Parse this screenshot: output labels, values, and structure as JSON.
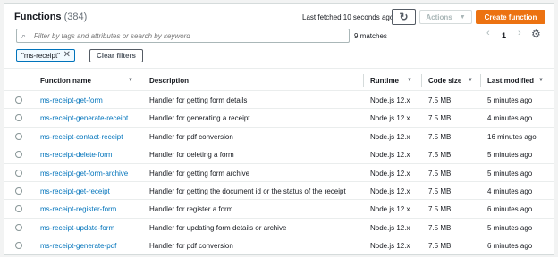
{
  "header": {
    "title": "Functions",
    "count": "(384)",
    "last_fetched": "Last fetched 10 seconds ago",
    "actions_label": "Actions",
    "create_label": "Create function"
  },
  "search": {
    "placeholder": "Filter by tags and attributes or search by keyword",
    "matches": "9 matches"
  },
  "pagination": {
    "page": "1"
  },
  "filter": {
    "token": "\"ms-receipt\"",
    "clear_label": "Clear filters"
  },
  "columns": [
    "Function name",
    "Description",
    "Runtime",
    "Code size",
    "Last modified"
  ],
  "rows": [
    {
      "name": "ms-receipt-get-form",
      "description": "Handler for getting form details",
      "runtime": "Node.js 12.x",
      "size": "7.5 MB",
      "modified": "5 minutes ago"
    },
    {
      "name": "ms-receipt-generate-receipt",
      "description": "Handler for generating a receipt",
      "runtime": "Node.js 12.x",
      "size": "7.5 MB",
      "modified": "4 minutes ago"
    },
    {
      "name": "ms-receipt-contact-receipt",
      "description": "Handler for pdf conversion",
      "runtime": "Node.js 12.x",
      "size": "7.5 MB",
      "modified": "16 minutes ago"
    },
    {
      "name": "ms-receipt-delete-form",
      "description": "Handler for deleting a form",
      "runtime": "Node.js 12.x",
      "size": "7.5 MB",
      "modified": "5 minutes ago"
    },
    {
      "name": "ms-receipt-get-form-archive",
      "description": "Handler for getting form archive",
      "runtime": "Node.js 12.x",
      "size": "7.5 MB",
      "modified": "5 minutes ago"
    },
    {
      "name": "ms-receipt-get-receipt",
      "description": "Handler for getting the document id or the status of the receipt",
      "runtime": "Node.js 12.x",
      "size": "7.5 MB",
      "modified": "4 minutes ago"
    },
    {
      "name": "ms-receipt-register-form",
      "description": "Handler for register a form",
      "runtime": "Node.js 12.x",
      "size": "7.5 MB",
      "modified": "6 minutes ago"
    },
    {
      "name": "ms-receipt-update-form",
      "description": "Handler for updating form details or archive",
      "runtime": "Node.js 12.x",
      "size": "7.5 MB",
      "modified": "5 minutes ago"
    },
    {
      "name": "ms-receipt-generate-pdf",
      "description": "Handler for pdf conversion",
      "runtime": "Node.js 12.x",
      "size": "7.5 MB",
      "modified": "6 minutes ago"
    }
  ]
}
